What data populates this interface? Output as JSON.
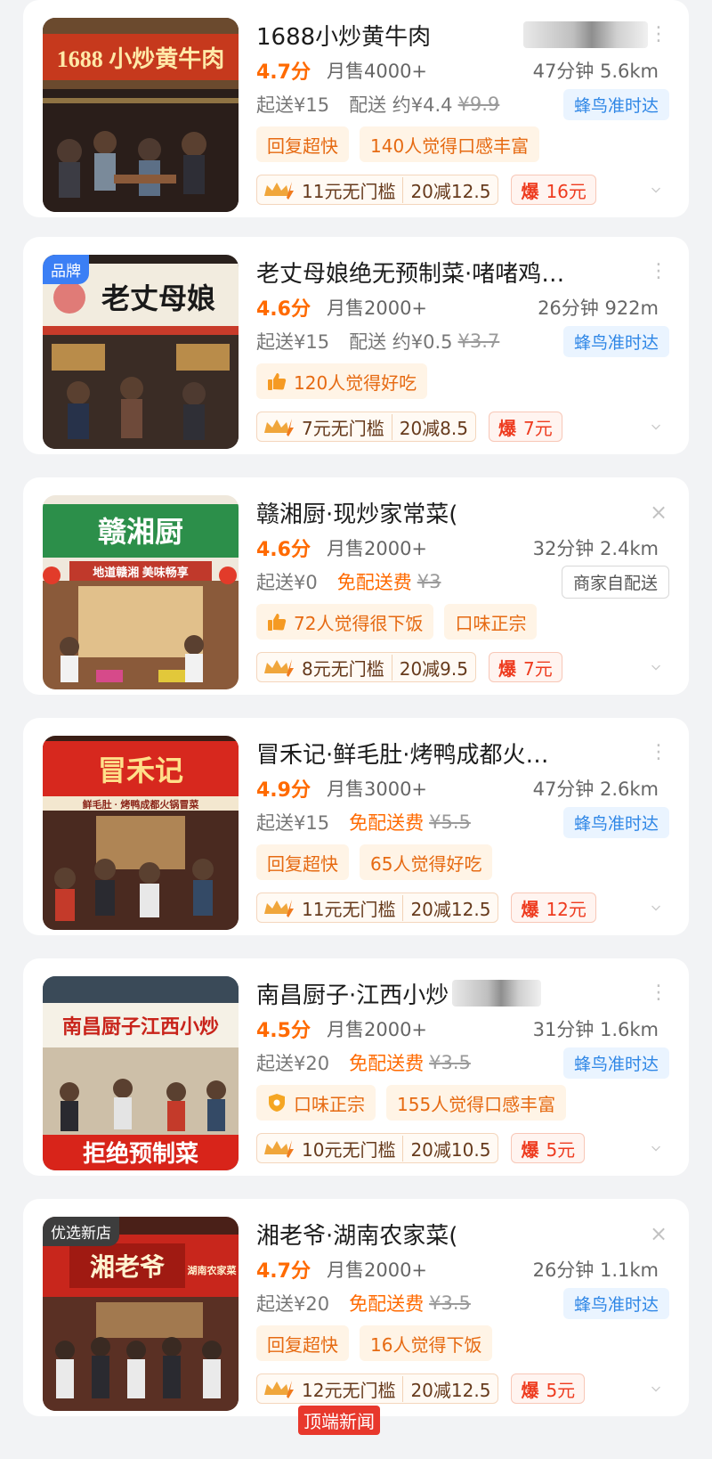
{
  "shops": [
    {
      "name": "1688小炒黄牛肉",
      "rating": "4.7分",
      "sales": "月售4000+",
      "time_dist": "47分钟 5.6km",
      "min_order": "起送¥15",
      "fee_label": "配送 约¥4.4",
      "fee_original": "¥9.9",
      "delivery": "蜂鸟准时达",
      "chips": [
        "回复超快",
        "140人觉得口感丰富"
      ],
      "offer_no_threshold": "11元无门槛",
      "offer_discount": "20减12.5",
      "burst_label": "爆",
      "burst_value": "16元",
      "sign_text": "1688 小炒黄牛肉"
    },
    {
      "tag": "品牌",
      "name": "老丈母娘绝无预制菜·啫啫鸡…",
      "rating": "4.6分",
      "sales": "月售2000+",
      "time_dist": "26分钟 922m",
      "min_order": "起送¥15",
      "fee_label": "配送 约¥0.5",
      "fee_original": "¥3.7",
      "delivery": "蜂鸟准时达",
      "chips": [
        "120人觉得好吃"
      ],
      "offer_no_threshold": "7元无门槛",
      "offer_discount": "20减8.5",
      "burst_label": "爆",
      "burst_value": "7元",
      "sign_text": "老丈母娘"
    },
    {
      "name": "赣湘厨·现炒家常菜(",
      "rating": "4.6分",
      "sales": "月售2000+",
      "time_dist": "32分钟 2.4km",
      "min_order": "起送¥0",
      "fee_free": "免配送费",
      "fee_original": "¥3",
      "delivery": "商家自配送",
      "chips": [
        "72人觉得很下饭",
        "口味正宗"
      ],
      "offer_no_threshold": "8元无门槛",
      "offer_discount": "20减9.5",
      "burst_label": "爆",
      "burst_value": "7元",
      "sign_text": "赣湘厨",
      "sub_text": "地道赣湘 美味畅享"
    },
    {
      "name": "冒禾记·鲜毛肚·烤鸭成都火…",
      "rating": "4.9分",
      "sales": "月售3000+",
      "time_dist": "47分钟 2.6km",
      "min_order": "起送¥15",
      "fee_free": "免配送费",
      "fee_original": "¥5.5",
      "delivery": "蜂鸟准时达",
      "chips": [
        "回复超快",
        "65人觉得好吃"
      ],
      "offer_no_threshold": "11元无门槛",
      "offer_discount": "20减12.5",
      "burst_label": "爆",
      "burst_value": "12元",
      "sign_text": "冒禾记",
      "sub_text": "鲜毛肚 · 烤鸭成都火锅冒菜"
    },
    {
      "name": "南昌厨子·江西小炒",
      "rating": "4.5分",
      "sales": "月售2000+",
      "time_dist": "31分钟 1.6km",
      "min_order": "起送¥20",
      "fee_free": "免配送费",
      "fee_original": "¥3.5",
      "delivery": "蜂鸟准时达",
      "chips": [
        "口味正宗",
        "155人觉得口感丰富"
      ],
      "offer_no_threshold": "10元无门槛",
      "offer_discount": "20减10.5",
      "burst_label": "爆",
      "burst_value": "5元",
      "sign_text": "南昌厨子江西小炒",
      "sub_text": "拒绝预制菜"
    },
    {
      "tag": "优选新店",
      "name": "湘老爷·湖南农家菜(",
      "rating": "4.7分",
      "sales": "月售2000+",
      "time_dist": "26分钟 1.1km",
      "min_order": "起送¥20",
      "fee_free": "免配送费",
      "fee_original": "¥3.5",
      "delivery": "蜂鸟准时达",
      "chips": [
        "回复超快",
        "16人觉得下饭"
      ],
      "offer_no_threshold": "12元无门槛",
      "offer_discount": "20减12.5",
      "burst_label": "爆",
      "burst_value": "5元",
      "sign_text": "湘老爷",
      "sub_text": "湖南农家菜"
    }
  ],
  "watermark": "顶端新闻",
  "colors": {
    "accent": "#ff6a00",
    "fengniao": "#2e86e6",
    "burst": "#ee3b1f"
  }
}
